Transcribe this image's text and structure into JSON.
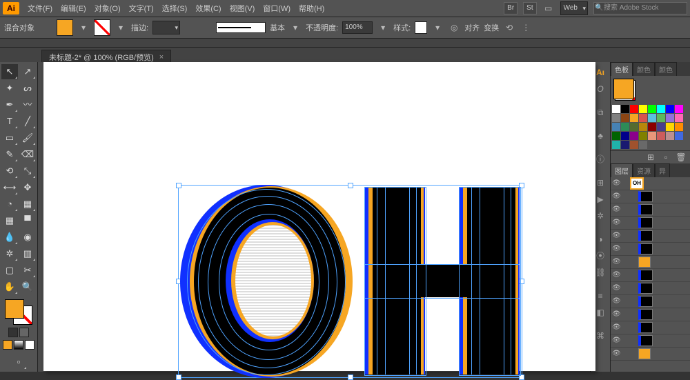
{
  "menubar": {
    "items": [
      "文件(F)",
      "编辑(E)",
      "对象(O)",
      "文字(T)",
      "选择(S)",
      "效果(C)",
      "视图(V)",
      "窗口(W)",
      "帮助(H)"
    ],
    "workspace": "Web",
    "search_placeholder": "搜索 Adobe Stock"
  },
  "ctrl": {
    "left_label": "混合对象",
    "stroke_label": "描边:",
    "stroke_menu": "▾",
    "style_box_label": "基本",
    "opacity_label": "不透明度:",
    "opacity_value": "100%",
    "style_label": "样式:",
    "align_label": "对齐",
    "transform_label": "变换"
  },
  "doc_tab": {
    "title": "未标题-2* @ 100% (RGB/预览)",
    "close": "×"
  },
  "panels": {
    "color_tab": "色板",
    "color_tab2": "颜色",
    "color_tab3": "颜色",
    "layers_tab": "图层",
    "layers_tab2": "资源",
    "layers_tab3": "异",
    "swatch_colors": [
      "#ffffff",
      "#000000",
      "#ff0000",
      "#ffff00",
      "#00ff00",
      "#00ffff",
      "#0000ff",
      "#ff00ff",
      "#808080",
      "#8b4513",
      "#f6a623",
      "#d9534f",
      "#5bc0de",
      "#5cb85c",
      "#9370db",
      "#ff69b4",
      "#4682b4",
      "#2e8b57",
      "#556b2f",
      "#b8860b",
      "#8b0000",
      "#483d8b",
      "#ffd700",
      "#ff8c00",
      "#006400",
      "#00008b",
      "#8b008b",
      "#808000",
      "#e9967a",
      "#cd5c5c",
      "#bc8f8f",
      "#4169e1",
      "#20b2aa",
      "#191970",
      "#a0522d",
      "#696969"
    ]
  },
  "layers": [
    {
      "thumb": "oh",
      "label": ""
    },
    {
      "thumb": "bar",
      "label": ""
    },
    {
      "thumb": "bar",
      "label": ""
    },
    {
      "thumb": "bar",
      "label": ""
    },
    {
      "thumb": "bar",
      "label": ""
    },
    {
      "thumb": "bar",
      "label": ""
    },
    {
      "thumb": "orange",
      "label": ""
    },
    {
      "thumb": "bar",
      "label": ""
    },
    {
      "thumb": "bar",
      "label": ""
    },
    {
      "thumb": "bar",
      "label": ""
    },
    {
      "thumb": "bar",
      "label": ""
    },
    {
      "thumb": "bar",
      "label": ""
    },
    {
      "thumb": "bar",
      "label": ""
    },
    {
      "thumb": "orange",
      "label": ""
    }
  ]
}
